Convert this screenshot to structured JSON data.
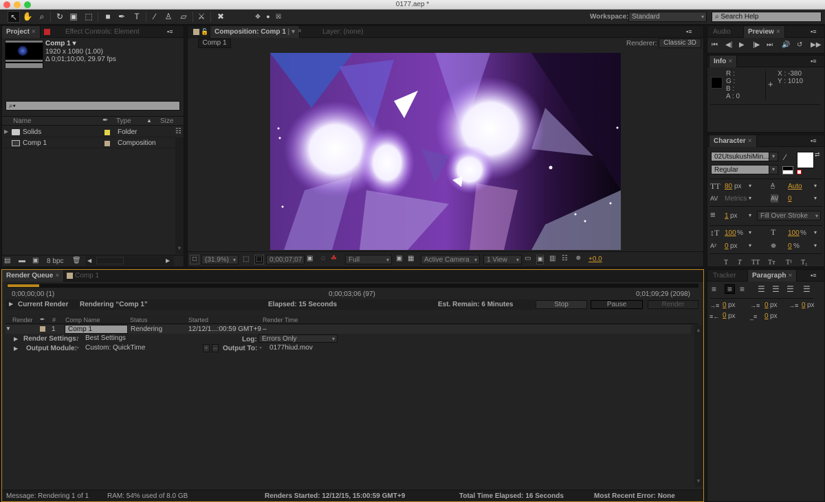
{
  "window": {
    "title": "0177.aep *"
  },
  "toolbar": {
    "workspace_label": "Workspace:",
    "workspace_value": "Standard",
    "search_placeholder": "Search Help"
  },
  "project_panel": {
    "tab_label": "Project",
    "effect_tab_label": "Effect Controls: Element",
    "comp_name": "Comp 1 ▾",
    "comp_size": "1920 x 1080 (1.00)",
    "comp_duration": "Δ 0;01;10;00, 29.97 fps",
    "search_placeholder": "⌕▾",
    "columns": [
      "Name",
      "Type",
      "Size"
    ],
    "items": [
      {
        "name": "Solids",
        "type": "Folder",
        "label_color": "#e3d24a"
      },
      {
        "name": "Comp 1",
        "type": "Composition",
        "label_color": "#bba98a"
      }
    ],
    "bpc": "8 bpc"
  },
  "composition_panel": {
    "tab_label": "Composition: Comp 1",
    "layer_tab_label": "Layer: (none)",
    "breadcrumb": "Comp 1",
    "renderer_label": "Renderer:",
    "renderer_value": "Classic 3D",
    "magnification": "(31.9%)",
    "timecode": "0;00;07;07",
    "resolution": "Full",
    "camera": "Active Camera",
    "views": "1 View",
    "exposure": "+0.0"
  },
  "preview_panel": {
    "audio_tab": "Audio",
    "tab_label": "Preview"
  },
  "info_panel": {
    "tab_label": "Info",
    "r": "R :",
    "g": "G :",
    "b": "B :",
    "a": "A : 0",
    "x": "X : -380",
    "y": "Y : 1010"
  },
  "character_panel": {
    "tab_label": "Character",
    "font": "02UtsukushiMin...",
    "style": "Regular",
    "font_size": "80",
    "font_size_unit": "px",
    "leading": "Auto",
    "kerning": "Metrics",
    "tracking": "0",
    "stroke_width": "1",
    "stroke_unit": "px",
    "stroke_mode": "Fill Over Stroke",
    "vert_scale": "100",
    "horiz_scale": "100",
    "baseline_shift": "0",
    "tsume": "0",
    "pct": "%"
  },
  "paragraph_panel": {
    "tracker_tab": "Tracker",
    "tab_label": "Paragraph",
    "indent_left": "0",
    "indent_first": "0",
    "indent_right": "0",
    "space_before": "0",
    "space_after": "0",
    "unit": "px"
  },
  "render_queue": {
    "tab_label": "Render Queue",
    "comp_tab_label": "Comp 1",
    "progress": 0.046,
    "start_time": "0;00;00;00 (1)",
    "current_time": "0;00;03;06 (97)",
    "end_time": "0;01;09;29 (2098)",
    "current_render_label": "Current Render",
    "rendering_text": "Rendering “Comp 1”",
    "elapsed": "Elapsed: 15 Seconds",
    "est_remain": "Est. Remain: 6 Minutes",
    "stop_label": "Stop",
    "pause_label": "Pause",
    "render_label": "Render",
    "columns": [
      "Render",
      "#",
      "Comp Name",
      "Status",
      "Started",
      "Render Time"
    ],
    "item": {
      "number": "1",
      "comp_name": "Comp 1",
      "status": "Rendering",
      "started": "12/12/1...:00:59 GMT+9",
      "render_time": "–",
      "render_settings_label": "Render Settings:",
      "render_settings_value": "Best Settings",
      "log_label": "Log:",
      "log_value": "Errors Only",
      "output_module_label": "Output Module:",
      "output_module_value": "Custom: QuickTime",
      "output_to_label": "Output To:",
      "output_to_value": "0177hiud.mov"
    },
    "status_bar": {
      "message": "Message: Rendering 1 of 1",
      "ram": "RAM: 54% used of 8.0 GB",
      "renders_started": "Renders Started: 12/12/15, 15:00:59 GMT+9",
      "total_time": "Total Time Elapsed: 16 Seconds",
      "recent_error": "Most Recent Error: None"
    }
  }
}
